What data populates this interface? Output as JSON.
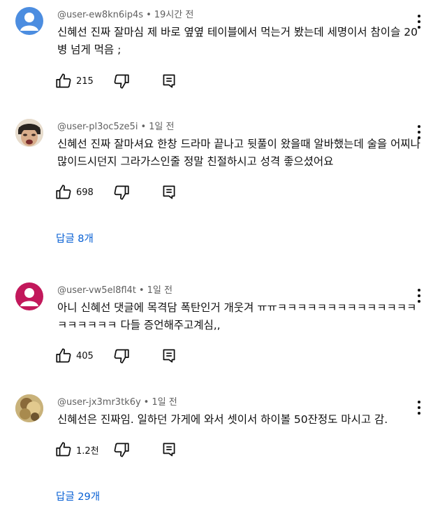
{
  "comments": [
    {
      "user": "@user-ew8kn6ip4s",
      "time": "19시간 전",
      "text": "신혜선 진짜 잘마심 제 바로 옆옆 테이블에서 먹는거 봤는데 세명이서 참이슬 20병 넘게 먹음 ;",
      "likes": "215",
      "avatar": "default-person-avatar",
      "avatar_color": "#4c8de0"
    },
    {
      "user": "@user-pl3oc5ze5i",
      "time": "1일 전",
      "text": "신혜선 진짜 잘마셔요 한창 드라마 끝나고 뒷풀이 왔을때 알바했는데 술을 어찌나 많이드시던지 그라가스인줄 정말 친절하시고 성격 좋으셨어요",
      "likes": "698",
      "avatar": "photo-avatar",
      "replies": "답글 8개"
    },
    {
      "user": "@user-vw5el8fl4t",
      "time": "1일 전",
      "text": "아니 신혜선 댓글에 목격담 폭탄인거 개웃겨 ㅠㅠㅋㅋㅋㅋㅋㅋㅋㅋㅋㅋㅋㅋㅋㅋㅋㅋㅋㅋㅋㅋ 다들 증언해주고계심,,",
      "likes": "405",
      "avatar": "default-person-avatar",
      "avatar_color": "#c2185b"
    },
    {
      "user": "@user-jx3mr3tk6y",
      "time": "1일 전",
      "text": "신혜선은 진짜임. 일하던 가게에 와서 셋이서 하이볼 50잔정도 마시고 감.",
      "likes": "1.2천",
      "avatar": "photo-avatar",
      "replies": "답글 29개"
    }
  ],
  "separator": "•",
  "colors": {
    "link": "#065fd4",
    "meta": "#606060"
  }
}
